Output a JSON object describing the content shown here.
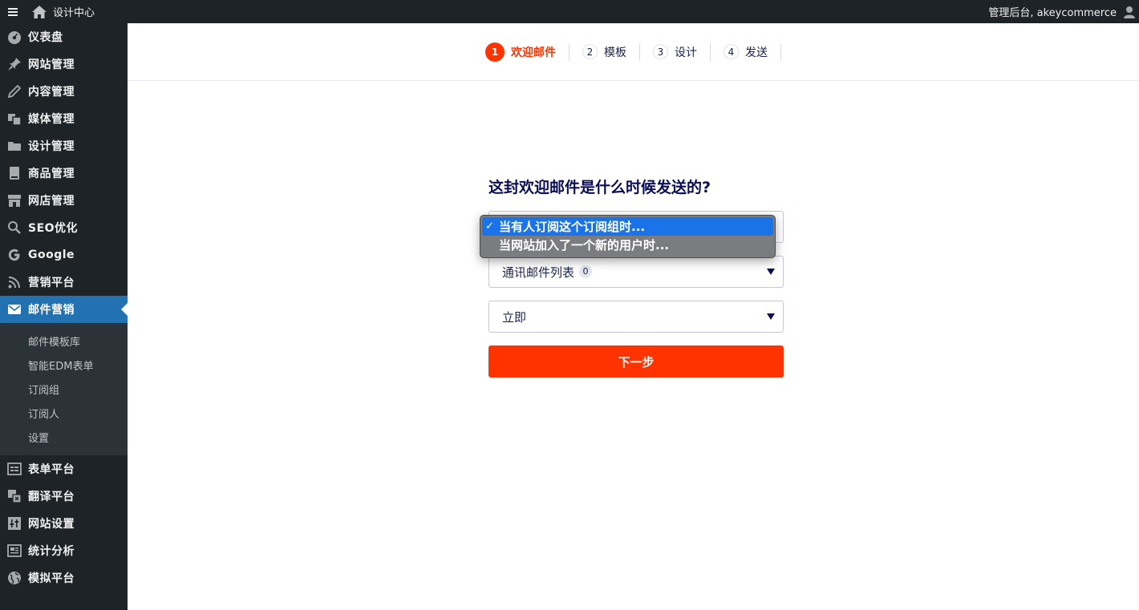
{
  "adminbar": {
    "site_name": "设计中心",
    "user_greeting": "管理后台, akeycommerce"
  },
  "sidebar": {
    "items": [
      {
        "label": "仪表盘",
        "icon": "dashboard-icon"
      },
      {
        "label": "网站管理",
        "icon": "pin-icon"
      },
      {
        "label": "内容管理",
        "icon": "pencil-icon"
      },
      {
        "label": "媒体管理",
        "icon": "media-icon"
      },
      {
        "label": "设计管理",
        "icon": "folder-icon"
      },
      {
        "label": "商品管理",
        "icon": "book-icon"
      },
      {
        "label": "网店管理",
        "icon": "store-icon"
      },
      {
        "label": "SEO优化",
        "icon": "search-icon"
      },
      {
        "label": "Google",
        "icon": "google-icon"
      },
      {
        "label": "营销平台",
        "icon": "rss-icon"
      },
      {
        "label": "邮件营销",
        "icon": "mail-icon"
      },
      {
        "label": "表单平台",
        "icon": "form-icon"
      },
      {
        "label": "翻译平台",
        "icon": "translate-icon"
      },
      {
        "label": "网站设置",
        "icon": "settings-sliders-icon"
      },
      {
        "label": "统计分析",
        "icon": "stats-icon"
      },
      {
        "label": "模拟平台",
        "icon": "globe-icon"
      }
    ],
    "submenu": [
      "邮件模板库",
      "智能EDM表单",
      "订阅组",
      "订阅人",
      "设置"
    ]
  },
  "steps": [
    {
      "num": "1",
      "label": "欢迎邮件"
    },
    {
      "num": "2",
      "label": "模板"
    },
    {
      "num": "3",
      "label": "设计"
    },
    {
      "num": "4",
      "label": "发送"
    }
  ],
  "form": {
    "question": "这封欢迎邮件是什么时候发送的?",
    "trigger_options": [
      "当有人订阅这个订阅组时...",
      "当网站加入了一个新的用户时..."
    ],
    "list_value": "通讯邮件列表",
    "list_count": "0",
    "timing_value": "立即",
    "next_label": "下一步"
  },
  "colors": {
    "accent": "#ff3300",
    "sidebar_bg": "#1d2327",
    "active_menu": "#2271b1",
    "selected_option": "#1a73e8"
  }
}
